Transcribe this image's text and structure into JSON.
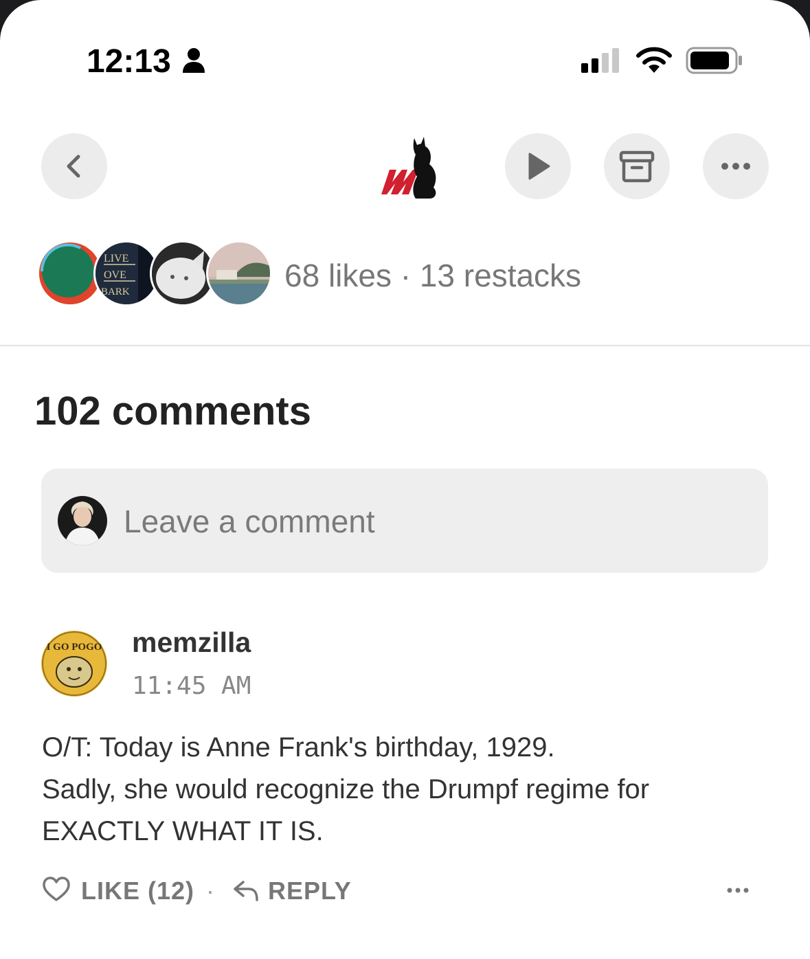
{
  "status_bar": {
    "time": "12:13"
  },
  "post": {
    "likes_text": "68 likes · 13 restacks"
  },
  "comments": {
    "title": "102 comments",
    "input_placeholder": "Leave a comment",
    "items": [
      {
        "author": "memzilla",
        "time": "11:45 AM",
        "body_lines": [
          "O/T: Today is Anne Frank's birthday, 1929.",
          "Sadly, she would recognize the Drumpf regime for",
          "EXACTLY WHAT IT IS."
        ],
        "like_label": "LIKE (12)",
        "separator": "·",
        "reply_label": "REPLY"
      }
    ]
  },
  "icons": {
    "back": "chevron-left-icon",
    "play": "play-icon",
    "archive": "archive-icon",
    "more": "ellipsis-icon",
    "like": "heart-icon",
    "reply": "reply-arrow-icon"
  },
  "avatar_texts": [
    "LIVE",
    "OVE",
    "BARK"
  ],
  "commenter_avatar_text": "I GO POGO"
}
